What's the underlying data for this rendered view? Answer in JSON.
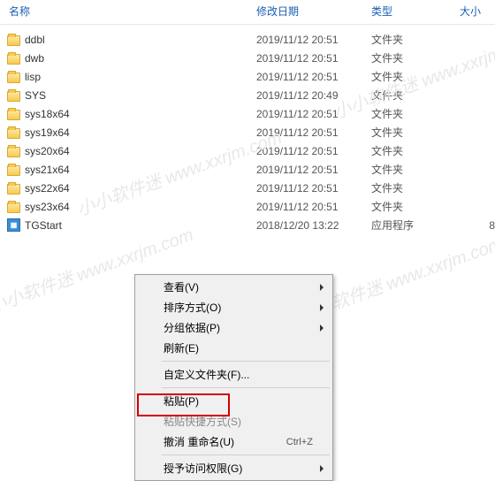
{
  "columns": {
    "name": "名称",
    "date": "修改日期",
    "type": "类型",
    "size": "大小"
  },
  "rows": [
    {
      "icon": "folder",
      "name": "ddbl",
      "date": "2019/11/12 20:51",
      "type": "文件夹",
      "size": ""
    },
    {
      "icon": "folder",
      "name": "dwb",
      "date": "2019/11/12 20:51",
      "type": "文件夹",
      "size": ""
    },
    {
      "icon": "folder",
      "name": "lisp",
      "date": "2019/11/12 20:51",
      "type": "文件夹",
      "size": ""
    },
    {
      "icon": "folder",
      "name": "SYS",
      "date": "2019/11/12 20:49",
      "type": "文件夹",
      "size": ""
    },
    {
      "icon": "folder",
      "name": "sys18x64",
      "date": "2019/11/12 20:51",
      "type": "文件夹",
      "size": ""
    },
    {
      "icon": "folder",
      "name": "sys19x64",
      "date": "2019/11/12 20:51",
      "type": "文件夹",
      "size": ""
    },
    {
      "icon": "folder",
      "name": "sys20x64",
      "date": "2019/11/12 20:51",
      "type": "文件夹",
      "size": ""
    },
    {
      "icon": "folder",
      "name": "sys21x64",
      "date": "2019/11/12 20:51",
      "type": "文件夹",
      "size": ""
    },
    {
      "icon": "folder",
      "name": "sys22x64",
      "date": "2019/11/12 20:51",
      "type": "文件夹",
      "size": ""
    },
    {
      "icon": "folder",
      "name": "sys23x64",
      "date": "2019/11/12 20:51",
      "type": "文件夹",
      "size": ""
    },
    {
      "icon": "app",
      "name": "TGStart",
      "date": "2018/12/20 13:22",
      "type": "应用程序",
      "size": "8"
    }
  ],
  "menu": {
    "view": "查看(V)",
    "sort": "排序方式(O)",
    "group": "分组依据(P)",
    "refresh": "刷新(E)",
    "customize": "自定义文件夹(F)...",
    "paste": "粘贴(P)",
    "pasteShort": "粘贴快捷方式(S)",
    "undo": "撤消 重命名(U)",
    "undoKey": "Ctrl+Z",
    "grant": "授予访问权限(G)"
  },
  "watermark": "小小软件迷  www.xxrjm.com"
}
